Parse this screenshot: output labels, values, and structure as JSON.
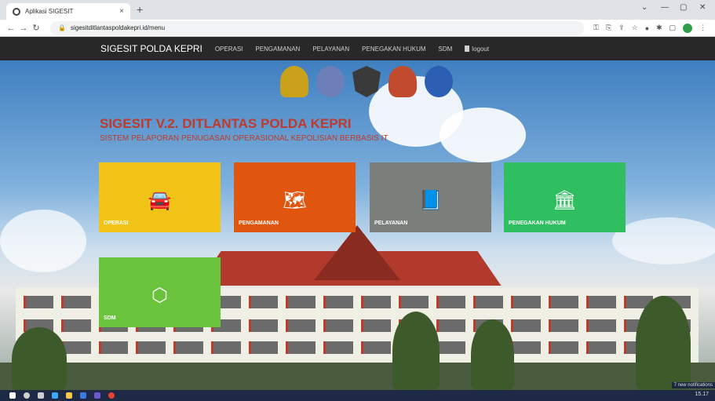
{
  "browser": {
    "tab_title": "Aplikasi SIGESIT",
    "tab_close": "×",
    "new_tab": "+",
    "url": "sigesitditlantaspoldakepri.id/menu",
    "window_controls": [
      "⌄",
      "—",
      "▢",
      "✕"
    ]
  },
  "nav": {
    "brand": "SIGESIT POLDA KEPRI",
    "links": [
      "OPERASI",
      "PENGAMANAN",
      "PELAYANAN",
      "PENEGAKAN HUKUM",
      "SDM"
    ],
    "logout": "logout"
  },
  "header": {
    "title": "SIGESIT V.2. DITLANTAS POLDA KEPRI",
    "subtitle": "SISTEM PELAPORAN PENUGASAN OPERASIONAL KEPOLISIAN BERBASIS IT"
  },
  "tiles": [
    {
      "label": "OPERASI",
      "icon": "car-icon",
      "color": "#f2c418"
    },
    {
      "label": "PENGAMANAN",
      "icon": "map-icon",
      "color": "#e0560e"
    },
    {
      "label": "PELAYANAN",
      "icon": "book-icon",
      "color": "#7a7f7c"
    },
    {
      "label": "PENEGAKAN HUKUM",
      "icon": "institution-icon",
      "color": "#2fbf60"
    },
    {
      "label": "SDM",
      "icon": "cubes-icon",
      "color": "#6ac33c"
    }
  ],
  "taskbar": {
    "time": "15.17",
    "notification": "7 new notifications"
  }
}
